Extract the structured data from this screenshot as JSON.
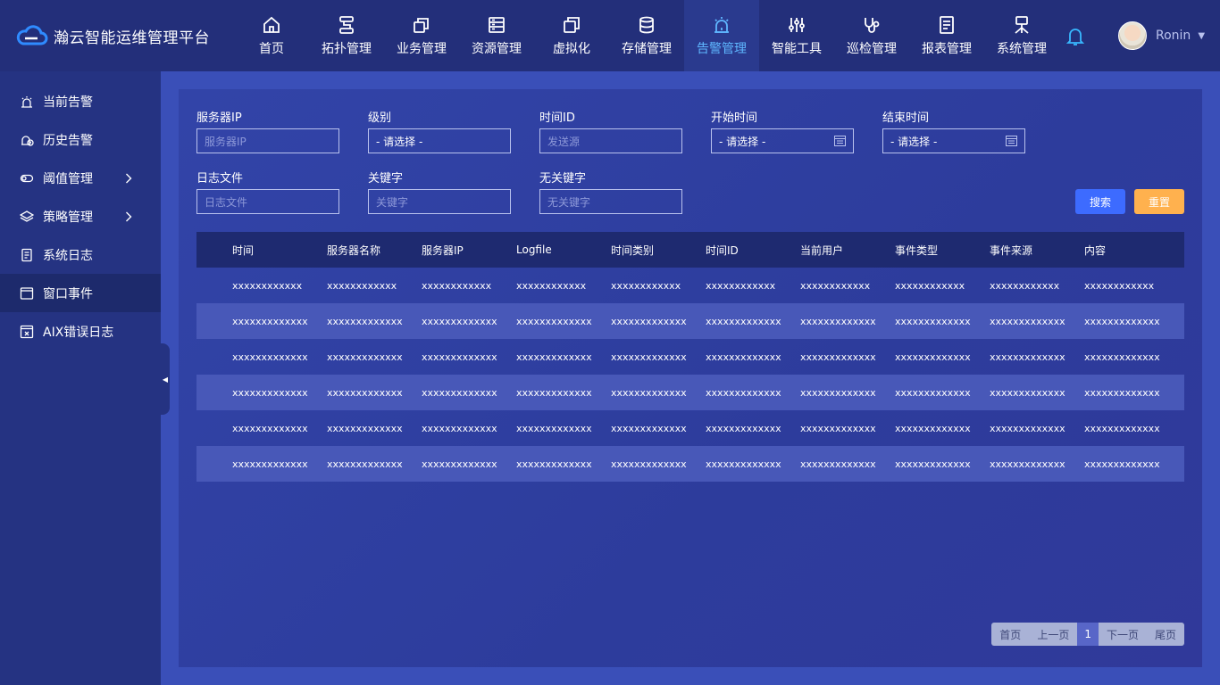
{
  "brand": {
    "title": "瀚云智能运维管理平台"
  },
  "nav": [
    {
      "label": "首页",
      "icon": "home-icon"
    },
    {
      "label": "拓扑管理",
      "icon": "topology-icon"
    },
    {
      "label": "业务管理",
      "icon": "business-icon"
    },
    {
      "label": "资源管理",
      "icon": "resource-icon"
    },
    {
      "label": "虚拟化",
      "icon": "virtualization-icon"
    },
    {
      "label": "存储管理",
      "icon": "storage-icon"
    },
    {
      "label": "告警管理",
      "icon": "alarm-icon",
      "active": true
    },
    {
      "label": "智能工具",
      "icon": "tools-icon"
    },
    {
      "label": "巡检管理",
      "icon": "inspection-icon"
    },
    {
      "label": "报表管理",
      "icon": "report-icon"
    },
    {
      "label": "系统管理",
      "icon": "system-icon"
    }
  ],
  "user": {
    "name": "Ronin"
  },
  "sidebar": [
    {
      "label": "当前告警",
      "icon": "alarm-icon"
    },
    {
      "label": "历史告警",
      "icon": "history-alarm-icon"
    },
    {
      "label": "阈值管理",
      "icon": "threshold-icon",
      "expandable": true
    },
    {
      "label": "策略管理",
      "icon": "layers-icon",
      "expandable": true
    },
    {
      "label": "系统日志",
      "icon": "log-icon"
    },
    {
      "label": "窗口事件",
      "icon": "window-icon",
      "active": true
    },
    {
      "label": "AIX错误日志",
      "icon": "error-log-icon"
    }
  ],
  "filters": {
    "server_ip": {
      "label": "服务器IP",
      "placeholder": "服务器IP"
    },
    "level": {
      "label": "级别",
      "value": "- 请选择 -"
    },
    "time_id": {
      "label": "时间ID",
      "placeholder": "发送源"
    },
    "start_time": {
      "label": "开始时间",
      "value": "- 请选择 -"
    },
    "end_time": {
      "label": "结束时间",
      "value": "- 请选择 -"
    },
    "log_file": {
      "label": "日志文件",
      "placeholder": "日志文件"
    },
    "keyword": {
      "label": "关键字",
      "placeholder": "关键字"
    },
    "exclude_keyword": {
      "label": "无关键字",
      "placeholder": "无关键字"
    }
  },
  "buttons": {
    "search": "搜索",
    "reset": "重置"
  },
  "table": {
    "columns": [
      "时间",
      "服务器名称",
      "服务器IP",
      "Logfile",
      "时间类别",
      "时间ID",
      "当前用户",
      "事件类型",
      "事件来源",
      "内容"
    ],
    "rows": [
      [
        "xxxxxxxxxxxx",
        "xxxxxxxxxxxx",
        "xxxxxxxxxxxx",
        "xxxxxxxxxxxx",
        "xxxxxxxxxxxx",
        "xxxxxxxxxxxx",
        "xxxxxxxxxxxx",
        "xxxxxxxxxxxx",
        "xxxxxxxxxxxx",
        "xxxxxxxxxxxx"
      ],
      [
        "xxxxxxxxxxxxx",
        "xxxxxxxxxxxxx",
        "xxxxxxxxxxxxx",
        "xxxxxxxxxxxxx",
        "xxxxxxxxxxxxx",
        "xxxxxxxxxxxxx",
        "xxxxxxxxxxxxx",
        "xxxxxxxxxxxxx",
        "xxxxxxxxxxxxx",
        "xxxxxxxxxxxxx"
      ],
      [
        "xxxxxxxxxxxxx",
        "xxxxxxxxxxxxx",
        "xxxxxxxxxxxxx",
        "xxxxxxxxxxxxx",
        "xxxxxxxxxxxxx",
        "xxxxxxxxxxxxx",
        "xxxxxxxxxxxxx",
        "xxxxxxxxxxxxx",
        "xxxxxxxxxxxxx",
        "xxxxxxxxxxxxx"
      ],
      [
        "xxxxxxxxxxxxx",
        "xxxxxxxxxxxxx",
        "xxxxxxxxxxxxx",
        "xxxxxxxxxxxxx",
        "xxxxxxxxxxxxx",
        "xxxxxxxxxxxxx",
        "xxxxxxxxxxxxx",
        "xxxxxxxxxxxxx",
        "xxxxxxxxxxxxx",
        "xxxxxxxxxxxxx"
      ],
      [
        "xxxxxxxxxxxxx",
        "xxxxxxxxxxxxx",
        "xxxxxxxxxxxxx",
        "xxxxxxxxxxxxx",
        "xxxxxxxxxxxxx",
        "xxxxxxxxxxxxx",
        "xxxxxxxxxxxxx",
        "xxxxxxxxxxxxx",
        "xxxxxxxxxxxxx",
        "xxxxxxxxxxxxx"
      ],
      [
        "xxxxxxxxxxxxx",
        "xxxxxxxxxxxxx",
        "xxxxxxxxxxxxx",
        "xxxxxxxxxxxxx",
        "xxxxxxxxxxxxx",
        "xxxxxxxxxxxxx",
        "xxxxxxxxxxxxx",
        "xxxxxxxxxxxxx",
        "xxxxxxxxxxxxx",
        "xxxxxxxxxxxxx"
      ]
    ]
  },
  "pagination": {
    "first": "首页",
    "prev": "上一页",
    "current": "1",
    "next": "下一页",
    "last": "尾页"
  },
  "colors": {
    "active_nav": "#5fb7ff",
    "search_button": "#3d6bff",
    "reset_button": "#ffb14e"
  }
}
